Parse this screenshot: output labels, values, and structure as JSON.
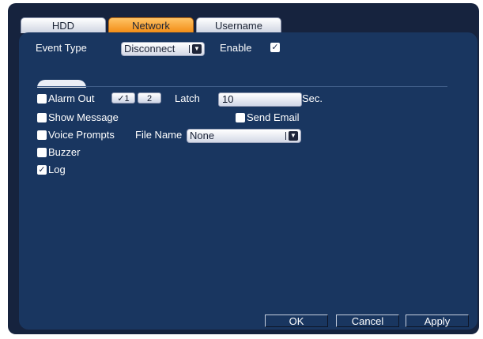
{
  "tabs": [
    {
      "label": "HDD",
      "active": false
    },
    {
      "label": "Network",
      "active": true
    },
    {
      "label": "Username",
      "active": false
    }
  ],
  "event_type": {
    "label": "Event Type",
    "value": "Disconnect"
  },
  "enable": {
    "label": "Enable",
    "checked": true
  },
  "alarm_out": {
    "label": "Alarm Out",
    "checked": false,
    "channel_1": "1",
    "channel_2": "2"
  },
  "latch": {
    "label": "Latch",
    "value": "10",
    "unit": "Sec."
  },
  "show_message": {
    "label": "Show Message",
    "checked": false
  },
  "send_email": {
    "label": "Send Email",
    "checked": false
  },
  "voice_prompts": {
    "label": "Voice Prompts",
    "checked": false
  },
  "file_name": {
    "label": "File Name",
    "value": "None"
  },
  "buzzer": {
    "label": "Buzzer",
    "checked": false
  },
  "log": {
    "label": "Log",
    "checked": true
  },
  "buttons": {
    "ok": "OK",
    "cancel": "Cancel",
    "apply": "Apply"
  },
  "colors": {
    "background": "#16233e",
    "panel": "#193660",
    "active_tab": "#f28a12"
  },
  "icons": {
    "check": "check-icon",
    "dropdown": "chevron-down-icon"
  }
}
